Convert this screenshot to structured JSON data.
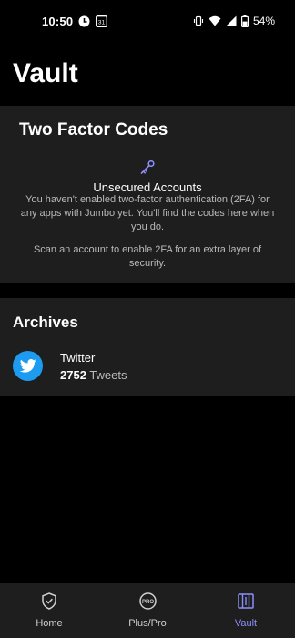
{
  "status_bar": {
    "time": "10:50",
    "battery": "54%",
    "icons": [
      "opera-icon",
      "calendar-31-icon",
      "vibrate-icon",
      "wifi-icon",
      "signal-icon",
      "battery-icon"
    ],
    "calendar_day": "31"
  },
  "page": {
    "title": "Vault"
  },
  "two_factor": {
    "title": "Two Factor Codes",
    "icon": "key-icon",
    "empty_title": "Unsecured Accounts",
    "empty_desc": "You haven't enabled two-factor authentication (2FA) for any apps with Jumbo yet. You'll find the codes here when you do.",
    "empty_hint": "Scan an account to enable 2FA for an extra layer of security."
  },
  "archives": {
    "title": "Archives",
    "items": [
      {
        "name": "Twitter",
        "count": "2752",
        "unit": "Tweets",
        "icon": "twitter-bird-icon"
      }
    ]
  },
  "bottom_nav": {
    "items": [
      {
        "label": "Home",
        "icon": "shield-check-icon",
        "active": false
      },
      {
        "label": "Plus/Pro",
        "icon": "pro-badge-icon",
        "badge": "PRO",
        "active": false
      },
      {
        "label": "Vault",
        "icon": "vault-icon",
        "active": true
      }
    ]
  },
  "colors": {
    "background": "#000000",
    "card": "#1e1e1e",
    "accent": "#8b8ef8",
    "twitter": "#1d9bf0"
  }
}
